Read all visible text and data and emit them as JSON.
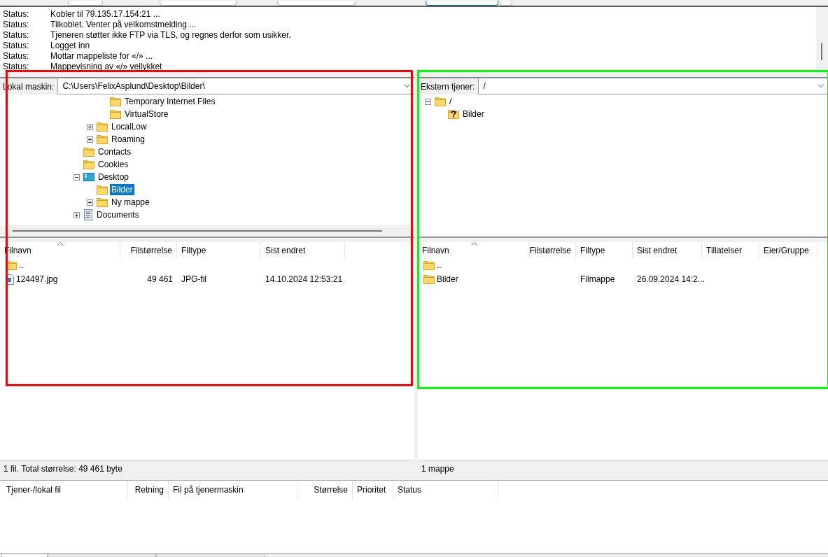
{
  "message_log": {
    "entries": [
      {
        "label": "Status:",
        "message": "Kobler til 79.135.17.154:21 ..."
      },
      {
        "label": "Status:",
        "message": "Tilkoblet. Venter på velkomstmelding ..."
      },
      {
        "label": "Status:",
        "message": "Tjeneren støtter ikke FTP via TLS, og regnes derfor som usikker."
      },
      {
        "label": "Status:",
        "message": "Logget inn"
      },
      {
        "label": "Status:",
        "message": "Mottar mappeliste for «/» ..."
      },
      {
        "label": "Status:",
        "message": "Mappevisning av «/» vellykket"
      }
    ]
  },
  "panes": [
    {
      "location_label": "Lokal maskin:",
      "path": "C:\\Users\\FelixAsplund\\Desktop\\Bilder\\",
      "color": "#ff0000",
      "tree": [
        {
          "children": [
            {
              "children": [
                {
                  "label": "Temporary Internet Files",
                  "kind": "folder",
                  "selected": false
                },
                {
                  "label": "VirtualStore",
                  "kind": "folder",
                  "selected": false
                }
              ]
            },
            {
              "label": "LocalLow",
              "kind": "folder",
              "expanded": false,
              "selected": false
            },
            {
              "label": "Roaming",
              "kind": "folder",
              "expanded": false,
              "selected": false
            }
          ]
        },
        {
          "label": "Contacts",
          "kind": "folder",
          "selected": false
        },
        {
          "label": "Cookies",
          "kind": "folder",
          "selected": false
        },
        {
          "label": "Desktop",
          "kind": "desktop",
          "expanded": true,
          "selected": false,
          "children": [
            {
              "label": "Bilder",
              "kind": "folder",
              "selected": true
            },
            {
              "label": "Ny mappe",
              "kind": "folder",
              "expanded": false,
              "selected": false
            }
          ]
        },
        {
          "label": "Documents",
          "kind": "documents",
          "expanded": false,
          "selected": false
        }
      ],
      "columns": [
        {
          "label": "Filnavn",
          "sorted": true
        },
        {
          "label": "Filstørrelse",
          "sorted": false
        },
        {
          "label": "Filtype",
          "sorted": false
        },
        {
          "label": "Sist endret",
          "sorted": false
        }
      ],
      "rows": [
        {
          "kind": "folder",
          "cells": [
            "..",
            null,
            null,
            null
          ]
        },
        {
          "kind": "image",
          "cells": [
            "124497.jpg",
            "49 461",
            "JPG-fil",
            "14.10.2024 12:53:21"
          ]
        }
      ],
      "status": "1 fil. Total størrelse: 49 461 byte"
    },
    {
      "location_label": "Ekstern tjener:",
      "path": "/",
      "color": "#00ff00",
      "tree": [
        {
          "label": "/",
          "kind": "folder",
          "expanded": true,
          "selected": false,
          "children": [
            {
              "label": "Bilder",
              "kind": "unknown",
              "selected": false
            }
          ]
        }
      ],
      "columns": [
        {
          "label": "Filnavn",
          "sorted": true
        },
        {
          "label": "Filstørrelse",
          "sorted": false
        },
        {
          "label": "Filtype",
          "sorted": false
        },
        {
          "label": "Sist endret",
          "sorted": false
        },
        {
          "label": "Tillatelser",
          "sorted": false
        },
        {
          "label": "Eier/Gruppe",
          "sorted": false
        }
      ],
      "rows": [
        {
          "kind": "folder",
          "cells": [
            "..",
            null,
            null,
            null,
            null,
            null
          ]
        },
        {
          "kind": "folder",
          "cells": [
            "Bilder",
            null,
            "Filmappe",
            "26.09.2024 14:2...",
            null,
            null
          ]
        }
      ],
      "status": "1 mappe"
    }
  ],
  "bottom_tabs": [
    {
      "selected": true
    },
    {
      "selected": false
    },
    {
      "selected": false
    }
  ],
  "queue": {
    "columns": [
      {
        "label": "Tjener-/lokal fil"
      },
      {
        "label": "Retning"
      },
      {
        "label": "Fil på tjenermaskin"
      },
      {
        "label": "Størrelse"
      },
      {
        "label": "Prioritet"
      },
      {
        "label": "Status"
      }
    ]
  }
}
